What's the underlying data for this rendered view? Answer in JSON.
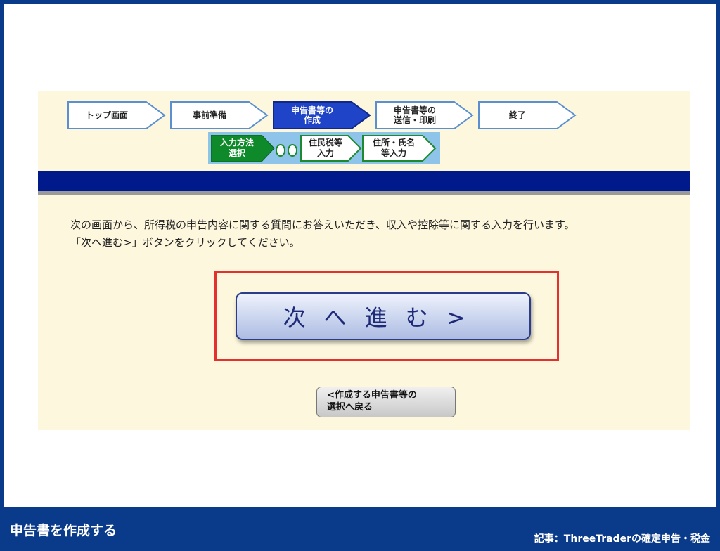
{
  "steps": [
    {
      "label": "トップ画面"
    },
    {
      "label": "事前準備"
    },
    {
      "label": "申告書等の\n作成"
    },
    {
      "label": "申告書等の\n送信・印刷"
    },
    {
      "label": "終了"
    }
  ],
  "substeps": [
    {
      "label": "入力方法\n選択"
    },
    {
      "label": "住民税等\n入力"
    },
    {
      "label": "住所・氏名\n等入力"
    }
  ],
  "instructions": {
    "line1": "次の画面から、所得税の申告内容に関する質問にお答えいただき、収入や控除等に関する入力を行います。",
    "line2": "「次へ進む>」ボタンをクリックしてください。"
  },
  "buttons": {
    "next": "次へ進む>",
    "back": "<作成する申告書等の\n選択へ戻る"
  },
  "footer": {
    "title": "申告書を作成する",
    "credit": "記事：ThreeTraderの確定申告・税金"
  },
  "colors": {
    "frame": "#0a3a8a",
    "panel": "#fdf7de",
    "active_step": "#1f44c8",
    "active_substep": "#0f8a2a",
    "highlight": "#e53030"
  }
}
